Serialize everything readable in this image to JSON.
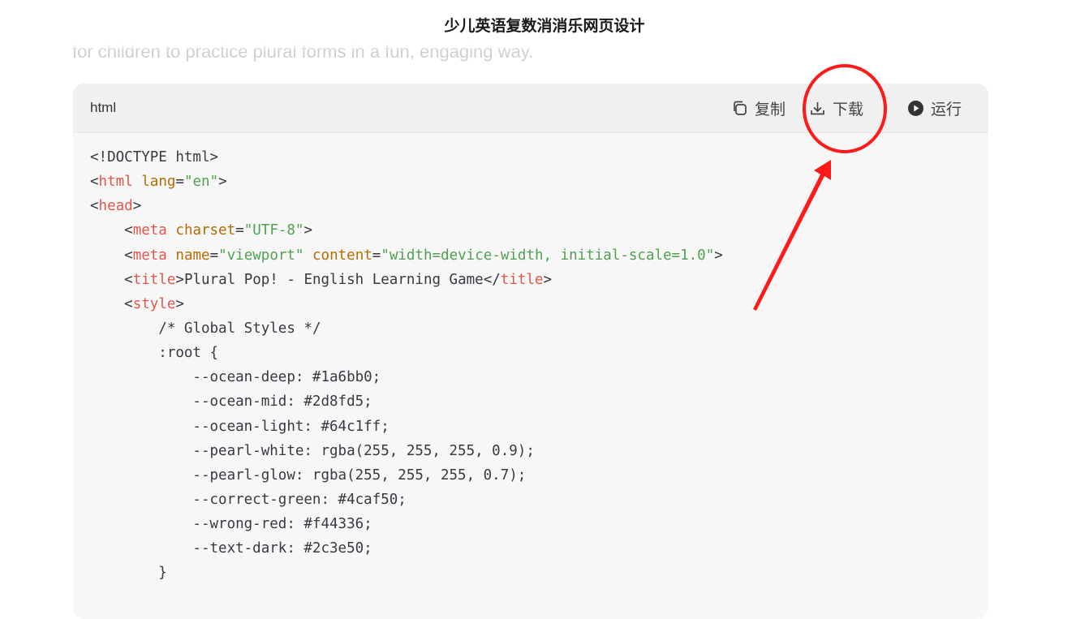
{
  "page": {
    "title": "少儿英语复数消消乐网页设计",
    "faded_text": "for children to practice plural forms in a fun, engaging way."
  },
  "code_block": {
    "language": "html",
    "actions": {
      "copy_label": "复制",
      "download_label": "下载",
      "run_label": "运行"
    },
    "lines": [
      [
        {
          "t": "plain",
          "v": "<!DOCTYPE html>"
        }
      ],
      [
        {
          "t": "punc",
          "v": "<"
        },
        {
          "t": "tag",
          "v": "html"
        },
        {
          "t": "plain",
          "v": " "
        },
        {
          "t": "attr",
          "v": "lang"
        },
        {
          "t": "punc",
          "v": "="
        },
        {
          "t": "str",
          "v": "\"en\""
        },
        {
          "t": "punc",
          "v": ">"
        }
      ],
      [
        {
          "t": "punc",
          "v": "<"
        },
        {
          "t": "tag",
          "v": "head"
        },
        {
          "t": "punc",
          "v": ">"
        }
      ],
      [
        {
          "t": "plain",
          "v": "    "
        },
        {
          "t": "punc",
          "v": "<"
        },
        {
          "t": "tag",
          "v": "meta"
        },
        {
          "t": "plain",
          "v": " "
        },
        {
          "t": "attr",
          "v": "charset"
        },
        {
          "t": "punc",
          "v": "="
        },
        {
          "t": "str",
          "v": "\"UTF-8\""
        },
        {
          "t": "punc",
          "v": ">"
        }
      ],
      [
        {
          "t": "plain",
          "v": "    "
        },
        {
          "t": "punc",
          "v": "<"
        },
        {
          "t": "tag",
          "v": "meta"
        },
        {
          "t": "plain",
          "v": " "
        },
        {
          "t": "attr",
          "v": "name"
        },
        {
          "t": "punc",
          "v": "="
        },
        {
          "t": "str",
          "v": "\"viewport\""
        },
        {
          "t": "plain",
          "v": " "
        },
        {
          "t": "attr",
          "v": "content"
        },
        {
          "t": "punc",
          "v": "="
        },
        {
          "t": "str",
          "v": "\"width=device-width, initial-scale=1.0\""
        },
        {
          "t": "punc",
          "v": ">"
        }
      ],
      [
        {
          "t": "plain",
          "v": "    "
        },
        {
          "t": "punc",
          "v": "<"
        },
        {
          "t": "tag",
          "v": "title"
        },
        {
          "t": "punc",
          "v": ">"
        },
        {
          "t": "plain",
          "v": "Plural Pop! - English Learning Game"
        },
        {
          "t": "punc",
          "v": "</"
        },
        {
          "t": "tag",
          "v": "title"
        },
        {
          "t": "punc",
          "v": ">"
        }
      ],
      [
        {
          "t": "plain",
          "v": "    "
        },
        {
          "t": "punc",
          "v": "<"
        },
        {
          "t": "tag",
          "v": "style"
        },
        {
          "t": "punc",
          "v": ">"
        }
      ],
      [
        {
          "t": "plain",
          "v": "        "
        },
        {
          "t": "comment",
          "v": "/* Global Styles */"
        }
      ],
      [
        {
          "t": "plain",
          "v": "        :root {"
        }
      ],
      [
        {
          "t": "plain",
          "v": "            --ocean-deep: #1a6bb0;"
        }
      ],
      [
        {
          "t": "plain",
          "v": "            --ocean-mid: #2d8fd5;"
        }
      ],
      [
        {
          "t": "plain",
          "v": "            --ocean-light: #64c1ff;"
        }
      ],
      [
        {
          "t": "plain",
          "v": "            --pearl-white: rgba(255, 255, 255, 0.9);"
        }
      ],
      [
        {
          "t": "plain",
          "v": "            --pearl-glow: rgba(255, 255, 255, 0.7);"
        }
      ],
      [
        {
          "t": "plain",
          "v": "            --correct-green: #4caf50;"
        }
      ],
      [
        {
          "t": "plain",
          "v": "            --wrong-red: #f44336;"
        }
      ],
      [
        {
          "t": "plain",
          "v": "            --text-dark: #2c3e50;"
        }
      ],
      [
        {
          "t": "plain",
          "v": "        }"
        }
      ]
    ]
  },
  "annotation": {
    "color": "#ff1a1a",
    "target": "download-button"
  },
  "icons": {
    "copy": "copy-icon",
    "download": "download-icon",
    "run": "play-circle-icon"
  }
}
